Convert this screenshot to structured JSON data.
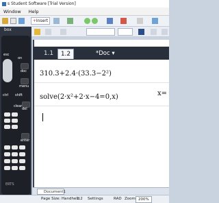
{
  "window": {
    "title": "s Student Software [Trial Version]"
  },
  "menu": [
    "Window",
    "Help"
  ],
  "toolbar": {
    "insert_label": "Insert"
  },
  "panel": {
    "label": "box"
  },
  "keypad": {
    "labels": [
      "esc",
      "on",
      "doc",
      "menu",
      "ctrl",
      "shift",
      "clear",
      "del",
      "enter",
      "ERTS"
    ]
  },
  "tabs": {
    "items": [
      "1.1",
      "1.2"
    ],
    "active_index": 1,
    "doc_name": "*Doc"
  },
  "math": {
    "line1": "310.3+2.4·(33.3−2²)",
    "line2": "solve(2·x²+2·x−4=0,x)",
    "result2": "x="
  },
  "bottom": {
    "doc_tab": "Document1"
  },
  "status": {
    "page_size_label": "Page Size: Handheld",
    "page": "1.2",
    "settings": "Settings",
    "mode": "RAD",
    "zoom_label": "Zoom:",
    "zoom_value": "200%"
  }
}
